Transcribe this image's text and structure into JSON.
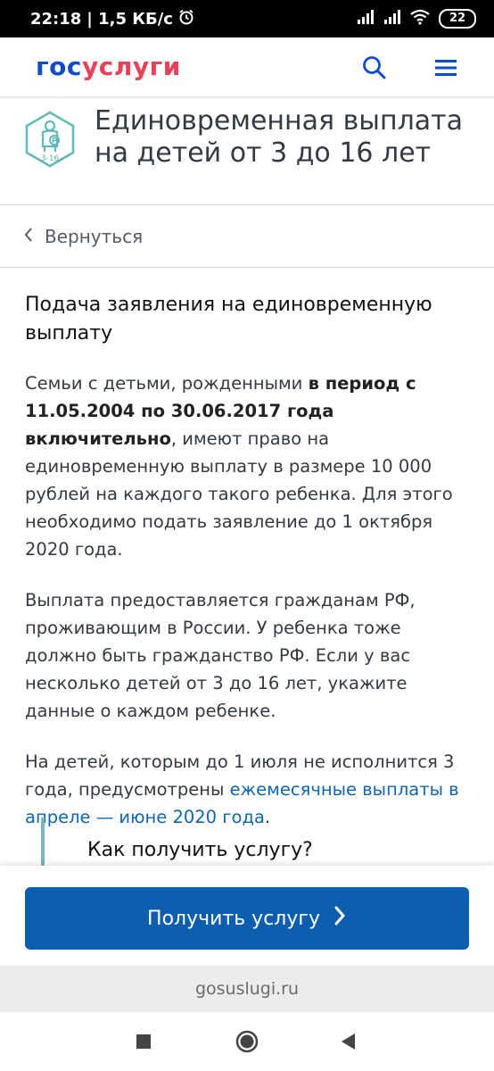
{
  "status_bar": {
    "time": "22:18",
    "network_speed": "| 1,5 КБ/с",
    "battery": "22",
    "icons": [
      "alarm-icon",
      "signal-icon",
      "signal-icon",
      "wifi-icon",
      "battery-icon"
    ]
  },
  "header": {
    "logo_part1": "гос",
    "logo_part2": "услуги",
    "icons": [
      "search-icon",
      "menu-icon"
    ],
    "brand_colors": {
      "blue": "#0d4cd3",
      "red": "#ee3f58"
    }
  },
  "service": {
    "icon_label": "3-16",
    "title": "Единовременная выплата на детей от 3 до 16 лет"
  },
  "back": {
    "label": "Вернуться"
  },
  "content": {
    "heading": "Подача заявления на единовременную выплату",
    "para1": {
      "part1": "Семьи с детьми, рожденными ",
      "bold": "в период с 11.05.2004 по 30.06.2017 года включительно",
      "part2": ", имеют право на единовременную выплату в размере 10 000 рублей на каждого такого ребенка. Для этого необходимо подать заявление до 1 октября 2020 года."
    },
    "para2": "Выплата предоставляется гражданам РФ, проживающим в России. У ребенка тоже должно быть гражданство РФ. Если у вас несколько детей от 3 до 16 лет, укажите данные о каждом ребенке.",
    "para3": {
      "part1": "На детей, которым до 1 июля не исполнится 3 года, предусмотрены ",
      "link": "ежемесячные выплаты в апреле — июне 2020 года",
      "part2": "."
    },
    "how_heading": "Как получить услугу?"
  },
  "button": {
    "label": "Получить услугу",
    "color": "#0d5eaf"
  },
  "browser": {
    "url": "gosuslugi.ru"
  },
  "nav": {
    "icons": [
      "recent-apps-icon",
      "home-icon",
      "back-icon"
    ]
  }
}
